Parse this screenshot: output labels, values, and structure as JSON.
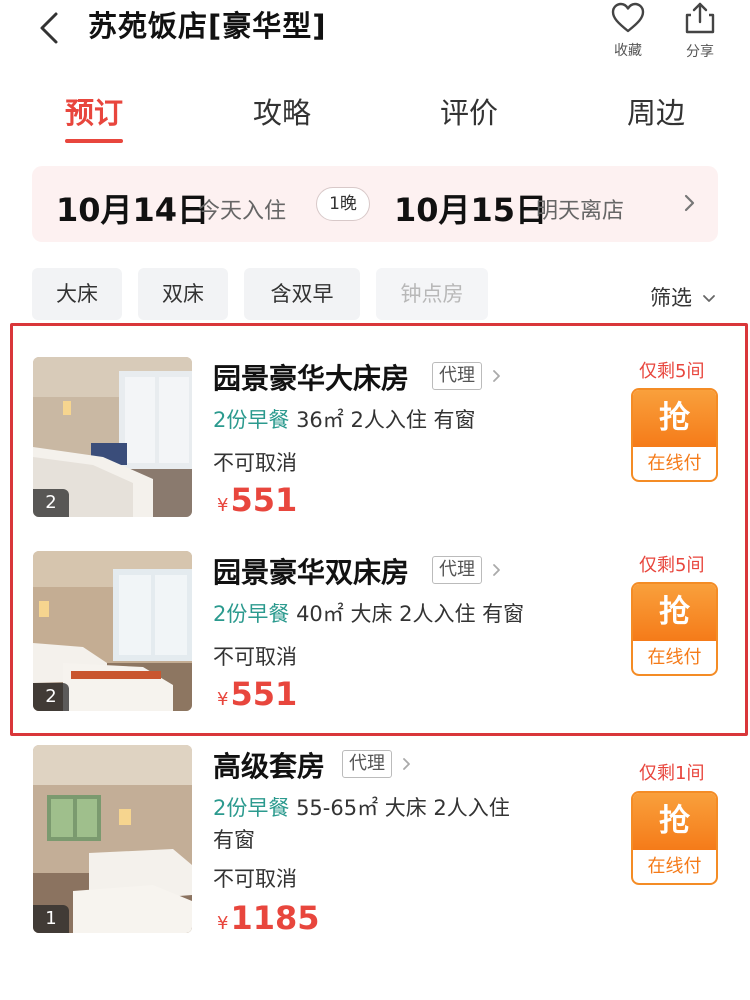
{
  "header": {
    "title": "苏苑饭店[豪华型]",
    "favorite_label": "收藏",
    "share_label": "分享"
  },
  "tabs": [
    {
      "label": "预订",
      "active": true
    },
    {
      "label": "攻略",
      "active": false
    },
    {
      "label": "评价",
      "active": false
    },
    {
      "label": "周边",
      "active": false
    }
  ],
  "stay": {
    "checkin_date": "10月14日",
    "checkin_label": "今天入住",
    "nights": "1晚",
    "checkout_date": "10月15日",
    "checkout_label": "明天离店"
  },
  "filters": {
    "chips": [
      "大床",
      "双床",
      "含双早",
      "钟点房"
    ],
    "filter_label": "筛选"
  },
  "rooms": [
    {
      "name": "园景豪华大床房",
      "agent": "代理",
      "breakfast": "2份早餐",
      "details": "36㎡ 2人入住 有窗",
      "cancel": "不可取消",
      "currency": "¥",
      "price": "551",
      "remaining": "仅剩5间",
      "buy_label": "抢",
      "pay_label": "在线付",
      "photo_count": "2"
    },
    {
      "name": "园景豪华双床房",
      "agent": "代理",
      "breakfast": "2份早餐",
      "details": "40㎡ 大床 2人入住 有窗",
      "cancel": "不可取消",
      "currency": "¥",
      "price": "551",
      "remaining": "仅剩5间",
      "buy_label": "抢",
      "pay_label": "在线付",
      "photo_count": "2"
    },
    {
      "name": "高级套房",
      "agent": "代理",
      "breakfast": "2份早餐",
      "details": "55-65㎡ 大床 2人入住",
      "details_line2": "有窗",
      "cancel": "不可取消",
      "currency": "¥",
      "price": "1185",
      "remaining": "仅剩1间",
      "buy_label": "抢",
      "pay_label": "在线付",
      "photo_count": "1"
    }
  ],
  "colors": {
    "accent": "#e8463d",
    "breakfast": "#2b9a8e",
    "buy_orange": "#f57b19",
    "highlight_border": "#d9363a"
  }
}
